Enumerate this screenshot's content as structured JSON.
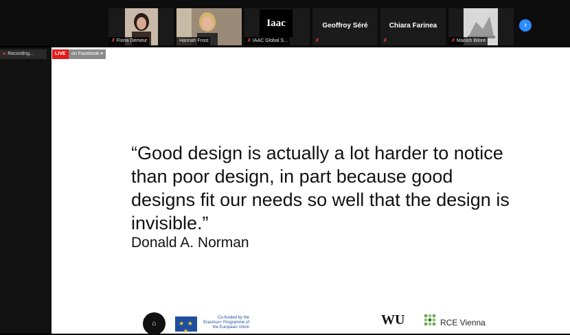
{
  "participants": [
    {
      "name": "Fiona Demeur",
      "muted": true,
      "kind": "photo"
    },
    {
      "name": "Hannah Frost",
      "muted": false,
      "kind": "photo",
      "active": true
    },
    {
      "name": "IAAC Global S...",
      "muted": true,
      "kind": "logo",
      "logo_text": "Iaac"
    },
    {
      "name": "Geoffroy Séré",
      "muted": true,
      "kind": "text"
    },
    {
      "name": "Chiara Farinea",
      "muted": true,
      "kind": "text"
    },
    {
      "name": "Manish Bilore",
      "muted": true,
      "kind": "photo"
    }
  ],
  "recording": {
    "label": "Recording..."
  },
  "live": {
    "badge": "LIVE",
    "platform": "on Facebook ▾"
  },
  "slide": {
    "quote": "“Good design is actually a lot harder to notice than poor design, in part because good designs fit our needs so well that the design is invisible.”",
    "author": "Donald A. Norman",
    "erasmus_text": "Co-funded by the Erasmus+ Programme of the European Union",
    "wu_text": "WU",
    "rce_text": "RCE Vienna"
  },
  "icons": {
    "next": "chevron-right-icon",
    "mic_off": "mic-off-icon"
  },
  "colors": {
    "live": "#e21a1a",
    "active_border": "#6fd16f",
    "accent": "#2d8cff",
    "muted_mic": "#e0463a"
  }
}
